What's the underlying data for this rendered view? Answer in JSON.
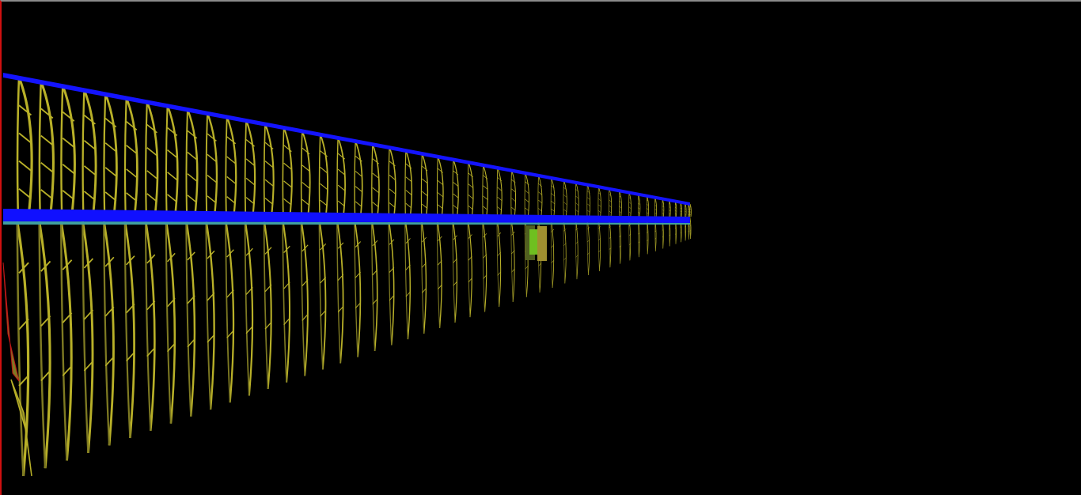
{
  "viewport": {
    "background": "#000000",
    "frame_left_color": "#d01010",
    "frame_top_color": "#8a8a8a"
  },
  "scene": {
    "description_icon": "3d-truss-frame-view",
    "frame_count": 48,
    "colors": {
      "frame": "#b8b028",
      "frame_dark": "#7e7a22",
      "top_chord": "#1414ff",
      "mid_beam": "#1010ff",
      "mid_beam_edge": "#40a0a0",
      "highlight_a": "#6fbf20",
      "highlight_b": "#a09030",
      "highlight_c": "#506020",
      "left_edge": "#c01818"
    }
  }
}
